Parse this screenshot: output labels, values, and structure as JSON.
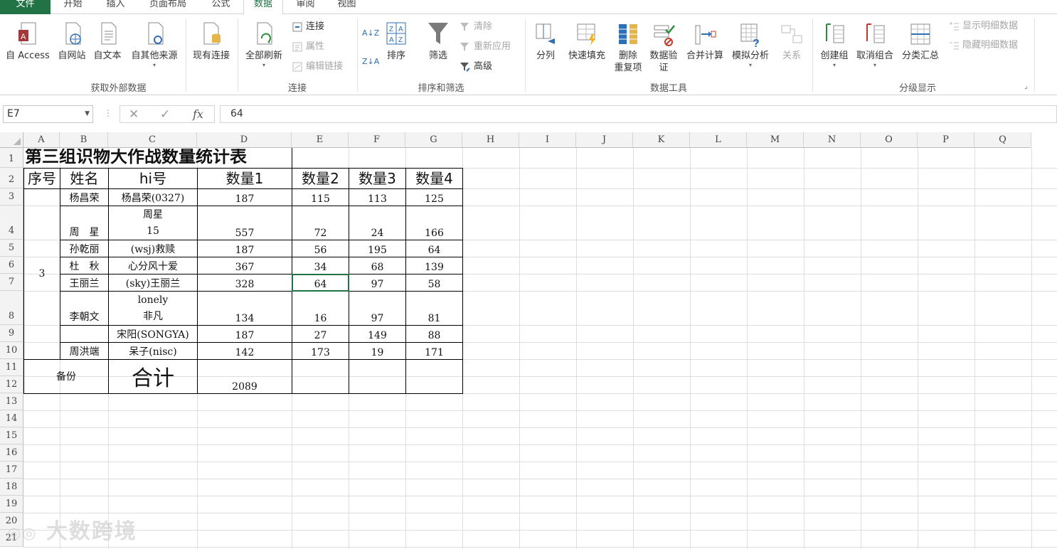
{
  "tabs": [
    "文件",
    "开始",
    "插入",
    "页面布局",
    "公式",
    "数据",
    "审阅",
    "视图"
  ],
  "ribbon": {
    "groups": {
      "external": "获取外部数据",
      "conn": "连接",
      "sort": "排序和筛选",
      "tools": "数据工具",
      "outline": "分级显示"
    },
    "buttons": {
      "access": "自 Access",
      "web": "自网站",
      "text": "自文本",
      "other": "自其他来源",
      "existing": "现有连接",
      "refresh": "全部刷新",
      "connections": "连接",
      "properties": "属性",
      "edit_links": "编辑链接",
      "sort": "排序",
      "filter": "筛选",
      "clear": "清除",
      "reapply": "重新应用",
      "advanced": "高级",
      "text_to_cols": "分列",
      "flash_fill": "快速填充",
      "remove_dup_1": "删除",
      "remove_dup_2": "重复项",
      "validation_1": "数据验",
      "validation_2": "证",
      "consolidate": "合并计算",
      "whatif": "模拟分析",
      "relations": "关系",
      "group": "创建组",
      "ungroup": "取消组合",
      "subtotal": "分类汇总",
      "show_detail": "显示明细数据",
      "hide_detail": "隐藏明细数据"
    }
  },
  "formula_bar": {
    "name_box": "E7",
    "fx": "fx",
    "value": "64"
  },
  "columns": [
    "A",
    "B",
    "C",
    "D",
    "E",
    "F",
    "G",
    "H",
    "I",
    "J",
    "K",
    "L",
    "M",
    "N",
    "O",
    "P",
    "Q"
  ],
  "rows": [
    "1",
    "2",
    "3",
    "4",
    "5",
    "6",
    "7",
    "8",
    "9",
    "10",
    "11",
    "12",
    "13",
    "14",
    "15",
    "16",
    "17",
    "18",
    "19",
    "20",
    "21"
  ],
  "sheet": {
    "title": "第三组识物大作战数量统计表",
    "headers": [
      "序号",
      "姓名",
      "hi号",
      "数量1",
      "数量2",
      "数量3",
      "数量4"
    ],
    "group_no": "3",
    "data": [
      {
        "name": "杨昌荣",
        "hi": "杨昌荣(0327)",
        "q1": "187",
        "q2": "115",
        "q3": "113",
        "q4": "125"
      },
      {
        "name": "周　星",
        "hi1": "周星",
        "hi2": "15",
        "q1": "557",
        "q2": "72",
        "q3": "24",
        "q4": "166"
      },
      {
        "name": "孙乾丽",
        "hi": "(wsj)救赎",
        "q1": "187",
        "q2": "56",
        "q3": "195",
        "q4": "64"
      },
      {
        "name": "杜　秋",
        "hi": "心分风十爱",
        "q1": "367",
        "q2": "34",
        "q3": "68",
        "q4": "139"
      },
      {
        "name": "王丽兰",
        "hi": "(sky)王丽兰",
        "q1": "328",
        "q2": "64",
        "q3": "97",
        "q4": "58"
      },
      {
        "name": "李朝文",
        "hi1": "lonely",
        "hi2": "非凡",
        "q1": "134",
        "q2": "16",
        "q3": "97",
        "q4": "81"
      },
      {
        "hi": "宋阳(SONGYA)",
        "q1": "187",
        "q2": "27",
        "q3": "149",
        "q4": "88"
      },
      {
        "name": "周洪端",
        "hi": "呆子(nisc)",
        "q1": "142",
        "q2": "173",
        "q3": "19",
        "q4": "171"
      }
    ],
    "backup": "备份",
    "total_label": "合计",
    "total_value": "2089"
  },
  "watermark": "大数跨境"
}
